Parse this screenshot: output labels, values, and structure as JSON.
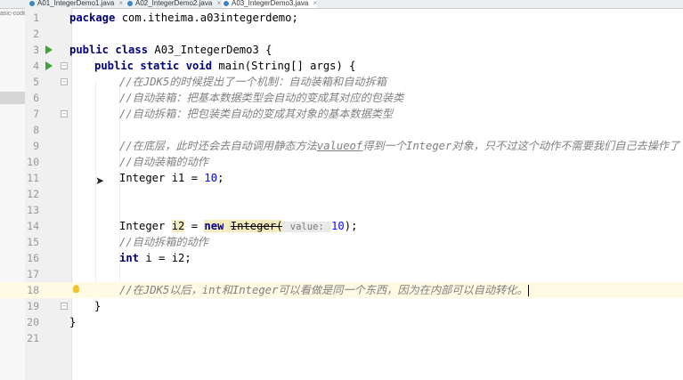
{
  "tabs": [
    {
      "label": "A01_IntegerDemo1.java",
      "close": "×"
    },
    {
      "label": "A02_IntegerDemo2.java",
      "close": "×"
    },
    {
      "label": "A03_IntegerDemo3.java",
      "close": "×"
    }
  ],
  "project_panel": {
    "text": "asic-code"
  },
  "editor": {
    "lines": [
      {
        "n": "1"
      },
      {
        "n": "2"
      },
      {
        "n": "3"
      },
      {
        "n": "4"
      },
      {
        "n": "5"
      },
      {
        "n": "6"
      },
      {
        "n": "7"
      },
      {
        "n": "8"
      },
      {
        "n": "9"
      },
      {
        "n": "10"
      },
      {
        "n": "11"
      },
      {
        "n": "12"
      },
      {
        "n": "13"
      },
      {
        "n": "14"
      },
      {
        "n": "15"
      },
      {
        "n": "16"
      },
      {
        "n": "17"
      },
      {
        "n": "18"
      },
      {
        "n": "19"
      },
      {
        "n": "20"
      },
      {
        "n": "21"
      }
    ],
    "code": {
      "l1_kw": "package",
      "l1_rest": " com.itheima.a03integerdemo;",
      "l3_kw": "public class",
      "l3_rest": " A03_IntegerDemo3 {",
      "l4_kw": "public static void",
      "l4_rest": " main(String[] args) {",
      "l5": "//在JDK5的时候提出了一个机制：自动装箱和自动拆箱",
      "l6": "//自动装箱：把基本数据类型会自动的变成其对应的包装类",
      "l7": "//自动拆箱：把包装类自动的变成其对象的基本数据类型",
      "l9_a": "//在底层，此时还会去自动调用静态方法",
      "l9_b": "valueof",
      "l9_c": "得到一个Integer对象，只不过这个动作不需要我们自己去操作了",
      "l10": "//自动装箱的动作",
      "l11_type": "Integer i1 = ",
      "l11_num": "10",
      "l11_end": ";",
      "l14_a": "Integer ",
      "l14_var": "i2",
      "l14_b": " = ",
      "l14_new": "new",
      "l14_sp": " ",
      "l14_cls": "Integer(",
      "l14_hint": " value: ",
      "l14_num": "10",
      "l14_end": ");",
      "l15": "//自动拆箱的动作",
      "l16_kw": "int",
      "l16_rest": " i = i2;",
      "l18": "//在JDK5以后，int和Integer可以看做是同一个东西，因为在内部可以自动转化。",
      "l19": "}",
      "l20": "}"
    }
  },
  "colors": {
    "keyword": "#000080",
    "comment": "#808080",
    "number": "#0000ff",
    "run_icon": "#3aa43a"
  }
}
